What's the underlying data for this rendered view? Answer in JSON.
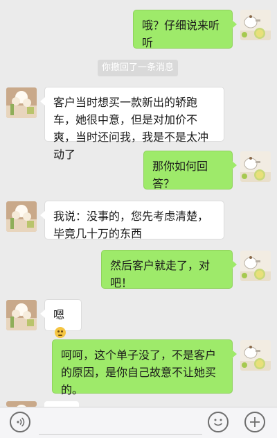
{
  "messages": [
    {
      "side": "right",
      "text": "哦？仔细说来听听"
    },
    {
      "side": "left",
      "text": "客户当时想买一款新出的轿跑车，她很中意，但是对加价不爽，当时还问我，我是不是太冲动了"
    },
    {
      "side": "right",
      "text": "那你如何回答？"
    },
    {
      "side": "left",
      "text": "我说：没事的，您先考虑清楚，毕竟几十万的东西"
    },
    {
      "side": "right",
      "text": "然后客户就走了，对吧！"
    },
    {
      "side": "left",
      "text": "嗯",
      "emoji": "smiling-face"
    },
    {
      "side": "right",
      "text": "呵呵，这个单子没了，不是客户的原因，是你自己故意不让她买的。"
    }
  ],
  "system_notice": "你撤回了一条消息",
  "input": {
    "value": "",
    "placeholder": ""
  },
  "icons": {
    "voice": "voice-icon",
    "emoji": "emoji-icon",
    "add": "plus-icon"
  },
  "colors": {
    "background": "#ebebeb",
    "right_bubble": "#9eea6a",
    "left_bubble": "#ffffff"
  }
}
